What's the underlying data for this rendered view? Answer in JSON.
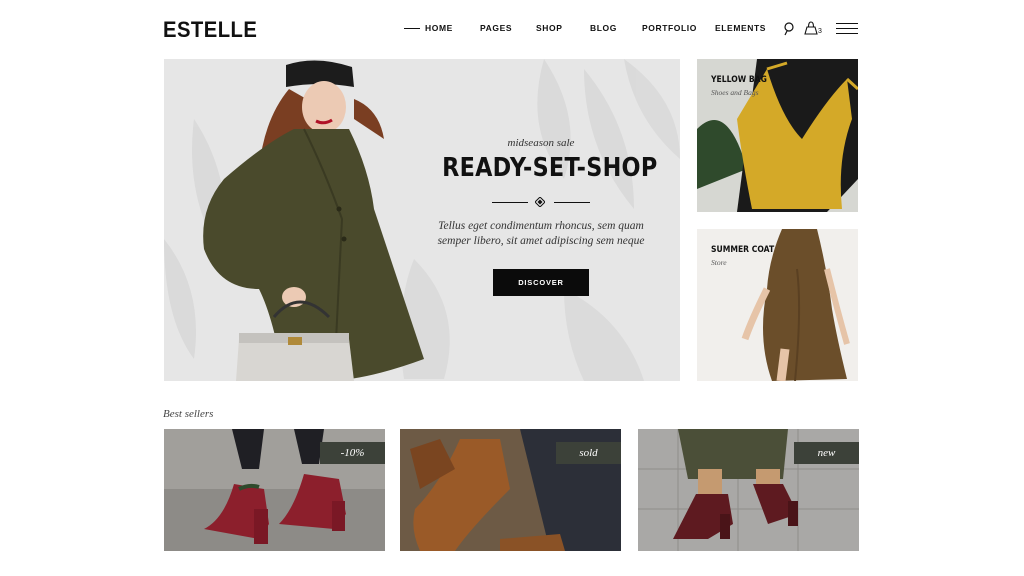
{
  "brand": {
    "logo": "ESTELLE"
  },
  "nav": {
    "items": [
      "HOME",
      "PAGES",
      "SHOP",
      "BLOG",
      "PORTFOLIO",
      "ELEMENTS"
    ],
    "active": "HOME"
  },
  "header_icons": {
    "search": "search-icon",
    "bag": "shopping-bag-icon",
    "bag_count": "3",
    "menu": "hamburger-menu-icon"
  },
  "hero": {
    "kicker": "midseason sale",
    "title": "READY-SET-SHOP",
    "description": "Tellus eget condimentum rhoncus, sem quam semper libero, sit amet adipiscing sem neque",
    "button_label": "DISCOVER"
  },
  "side_cards": [
    {
      "title": "YELLOW BAG",
      "subtitle": "Shoes and Bags"
    },
    {
      "title": "SUMMER COAT",
      "subtitle": "Store"
    }
  ],
  "best_sellers": {
    "label": "Best sellers",
    "products": [
      {
        "badge": "-10%"
      },
      {
        "badge": "sold"
      },
      {
        "badge": "new"
      }
    ]
  },
  "colors": {
    "accent": "#0b0b0b",
    "badge_bg": "#3c4139",
    "hero_bg": "#e6e6e6"
  }
}
